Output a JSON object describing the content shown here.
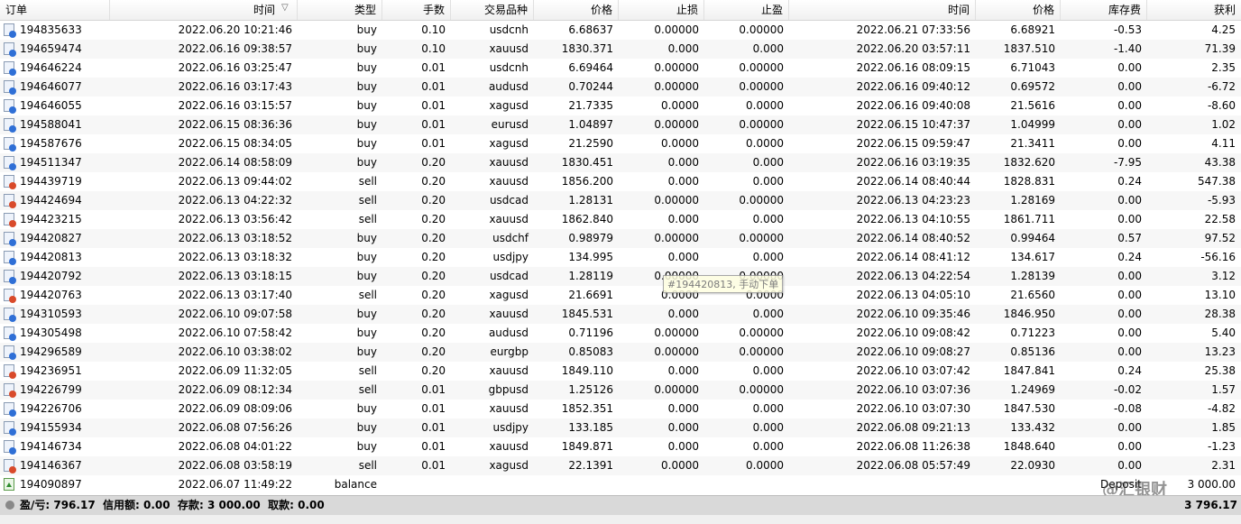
{
  "columns": [
    "订单",
    "时间",
    "类型",
    "手数",
    "交易品种",
    "价格",
    "止损",
    "止盈",
    "时间",
    "价格",
    "库存费",
    "获利"
  ],
  "sort_indicator": "▽",
  "rows": [
    {
      "order": "194835633",
      "open_time": "2022.06.20 10:21:46",
      "type": "buy",
      "lots": "0.10",
      "symbol": "usdcnh",
      "open_price": "6.68637",
      "sl": "0.00000",
      "tp": "0.00000",
      "close_time": "2022.06.21 07:33:56",
      "close_price": "6.68921",
      "swap": "-0.53",
      "profit": "4.25"
    },
    {
      "order": "194659474",
      "open_time": "2022.06.16 09:38:57",
      "type": "buy",
      "lots": "0.10",
      "symbol": "xauusd",
      "open_price": "1830.371",
      "sl": "0.000",
      "tp": "0.000",
      "close_time": "2022.06.20 03:57:11",
      "close_price": "1837.510",
      "swap": "-1.40",
      "profit": "71.39"
    },
    {
      "order": "194646224",
      "open_time": "2022.06.16 03:25:47",
      "type": "buy",
      "lots": "0.01",
      "symbol": "usdcnh",
      "open_price": "6.69464",
      "sl": "0.00000",
      "tp": "0.00000",
      "close_time": "2022.06.16 08:09:15",
      "close_price": "6.71043",
      "swap": "0.00",
      "profit": "2.35"
    },
    {
      "order": "194646077",
      "open_time": "2022.06.16 03:17:43",
      "type": "buy",
      "lots": "0.01",
      "symbol": "audusd",
      "open_price": "0.70244",
      "sl": "0.00000",
      "tp": "0.00000",
      "close_time": "2022.06.16 09:40:12",
      "close_price": "0.69572",
      "swap": "0.00",
      "profit": "-6.72"
    },
    {
      "order": "194646055",
      "open_time": "2022.06.16 03:15:57",
      "type": "buy",
      "lots": "0.01",
      "symbol": "xagusd",
      "open_price": "21.7335",
      "sl": "0.0000",
      "tp": "0.0000",
      "close_time": "2022.06.16 09:40:08",
      "close_price": "21.5616",
      "swap": "0.00",
      "profit": "-8.60"
    },
    {
      "order": "194588041",
      "open_time": "2022.06.15 08:36:36",
      "type": "buy",
      "lots": "0.01",
      "symbol": "eurusd",
      "open_price": "1.04897",
      "sl": "0.00000",
      "tp": "0.00000",
      "close_time": "2022.06.15 10:47:37",
      "close_price": "1.04999",
      "swap": "0.00",
      "profit": "1.02"
    },
    {
      "order": "194587676",
      "open_time": "2022.06.15 08:34:05",
      "type": "buy",
      "lots": "0.01",
      "symbol": "xagusd",
      "open_price": "21.2590",
      "sl": "0.0000",
      "tp": "0.0000",
      "close_time": "2022.06.15 09:59:47",
      "close_price": "21.3411",
      "swap": "0.00",
      "profit": "4.11"
    },
    {
      "order": "194511347",
      "open_time": "2022.06.14 08:58:09",
      "type": "buy",
      "lots": "0.20",
      "symbol": "xauusd",
      "open_price": "1830.451",
      "sl": "0.000",
      "tp": "0.000",
      "close_time": "2022.06.16 03:19:35",
      "close_price": "1832.620",
      "swap": "-7.95",
      "profit": "43.38"
    },
    {
      "order": "194439719",
      "open_time": "2022.06.13 09:44:02",
      "type": "sell",
      "lots": "0.20",
      "symbol": "xauusd",
      "open_price": "1856.200",
      "sl": "0.000",
      "tp": "0.000",
      "close_time": "2022.06.14 08:40:44",
      "close_price": "1828.831",
      "swap": "0.24",
      "profit": "547.38"
    },
    {
      "order": "194424694",
      "open_time": "2022.06.13 04:22:32",
      "type": "sell",
      "lots": "0.20",
      "symbol": "usdcad",
      "open_price": "1.28131",
      "sl": "0.00000",
      "tp": "0.00000",
      "close_time": "2022.06.13 04:23:23",
      "close_price": "1.28169",
      "swap": "0.00",
      "profit": "-5.93"
    },
    {
      "order": "194423215",
      "open_time": "2022.06.13 03:56:42",
      "type": "sell",
      "lots": "0.20",
      "symbol": "xauusd",
      "open_price": "1862.840",
      "sl": "0.000",
      "tp": "0.000",
      "close_time": "2022.06.13 04:10:55",
      "close_price": "1861.711",
      "swap": "0.00",
      "profit": "22.58"
    },
    {
      "order": "194420827",
      "open_time": "2022.06.13 03:18:52",
      "type": "buy",
      "lots": "0.20",
      "symbol": "usdchf",
      "open_price": "0.98979",
      "sl": "0.00000",
      "tp": "0.00000",
      "close_time": "2022.06.14 08:40:52",
      "close_price": "0.99464",
      "swap": "0.57",
      "profit": "97.52"
    },
    {
      "order": "194420813",
      "open_time": "2022.06.13 03:18:32",
      "type": "buy",
      "lots": "0.20",
      "symbol": "usdjpy",
      "open_price": "134.995",
      "sl": "0.000",
      "tp": "0.000",
      "close_time": "2022.06.14 08:41:12",
      "close_price": "134.617",
      "swap": "0.24",
      "profit": "-56.16"
    },
    {
      "order": "194420792",
      "open_time": "2022.06.13 03:18:15",
      "type": "buy",
      "lots": "0.20",
      "symbol": "usdcad",
      "open_price": "1.28119",
      "sl": "0.00000",
      "tp": "0.00000",
      "close_time": "2022.06.13 04:22:54",
      "close_price": "1.28139",
      "swap": "0.00",
      "profit": "3.12"
    },
    {
      "order": "194420763",
      "open_time": "2022.06.13 03:17:40",
      "type": "sell",
      "lots": "0.20",
      "symbol": "xagusd",
      "open_price": "21.6691",
      "sl": "0.0000",
      "tp": "0.0000",
      "close_time": "2022.06.13 04:05:10",
      "close_price": "21.6560",
      "swap": "0.00",
      "profit": "13.10"
    },
    {
      "order": "194310593",
      "open_time": "2022.06.10 09:07:58",
      "type": "buy",
      "lots": "0.20",
      "symbol": "xauusd",
      "open_price": "1845.531",
      "sl": "0.000",
      "tp": "0.000",
      "close_time": "2022.06.10 09:35:46",
      "close_price": "1846.950",
      "swap": "0.00",
      "profit": "28.38"
    },
    {
      "order": "194305498",
      "open_time": "2022.06.10 07:58:42",
      "type": "buy",
      "lots": "0.20",
      "symbol": "audusd",
      "open_price": "0.71196",
      "sl": "0.00000",
      "tp": "0.00000",
      "close_time": "2022.06.10 09:08:42",
      "close_price": "0.71223",
      "swap": "0.00",
      "profit": "5.40"
    },
    {
      "order": "194296589",
      "open_time": "2022.06.10 03:38:02",
      "type": "buy",
      "lots": "0.20",
      "symbol": "eurgbp",
      "open_price": "0.85083",
      "sl": "0.00000",
      "tp": "0.00000",
      "close_time": "2022.06.10 09:08:27",
      "close_price": "0.85136",
      "swap": "0.00",
      "profit": "13.23"
    },
    {
      "order": "194236951",
      "open_time": "2022.06.09 11:32:05",
      "type": "sell",
      "lots": "0.20",
      "symbol": "xauusd",
      "open_price": "1849.110",
      "sl": "0.000",
      "tp": "0.000",
      "close_time": "2022.06.10 03:07:42",
      "close_price": "1847.841",
      "swap": "0.24",
      "profit": "25.38"
    },
    {
      "order": "194226799",
      "open_time": "2022.06.09 08:12:34",
      "type": "sell",
      "lots": "0.01",
      "symbol": "gbpusd",
      "open_price": "1.25126",
      "sl": "0.00000",
      "tp": "0.00000",
      "close_time": "2022.06.10 03:07:36",
      "close_price": "1.24969",
      "swap": "-0.02",
      "profit": "1.57"
    },
    {
      "order": "194226706",
      "open_time": "2022.06.09 08:09:06",
      "type": "buy",
      "lots": "0.01",
      "symbol": "xauusd",
      "open_price": "1852.351",
      "sl": "0.000",
      "tp": "0.000",
      "close_time": "2022.06.10 03:07:30",
      "close_price": "1847.530",
      "swap": "-0.08",
      "profit": "-4.82"
    },
    {
      "order": "194155934",
      "open_time": "2022.06.08 07:56:26",
      "type": "buy",
      "lots": "0.01",
      "symbol": "usdjpy",
      "open_price": "133.185",
      "sl": "0.000",
      "tp": "0.000",
      "close_time": "2022.06.08 09:21:13",
      "close_price": "133.432",
      "swap": "0.00",
      "profit": "1.85"
    },
    {
      "order": "194146734",
      "open_time": "2022.06.08 04:01:22",
      "type": "buy",
      "lots": "0.01",
      "symbol": "xauusd",
      "open_price": "1849.871",
      "sl": "0.000",
      "tp": "0.000",
      "close_time": "2022.06.08 11:26:38",
      "close_price": "1848.640",
      "swap": "0.00",
      "profit": "-1.23"
    },
    {
      "order": "194146367",
      "open_time": "2022.06.08 03:58:19",
      "type": "sell",
      "lots": "0.01",
      "symbol": "xagusd",
      "open_price": "22.1391",
      "sl": "0.0000",
      "tp": "0.0000",
      "close_time": "2022.06.08 05:57:49",
      "close_price": "22.0930",
      "swap": "0.00",
      "profit": "2.31"
    },
    {
      "order": "194090897",
      "open_time": "2022.06.07 11:49:22",
      "type": "balance",
      "lots": "",
      "symbol": "",
      "open_price": "",
      "sl": "",
      "tp": "",
      "close_time": "",
      "close_price": "",
      "swap": "",
      "profit": "3 000.00"
    }
  ],
  "deposit_label": "Deposit",
  "tooltip": "#194420813, 手动下单",
  "footer": {
    "summary": "盈/亏: 796.17  信用额: 0.00  存款: 3 000.00  取款: 0.00",
    "total": "3 796.17"
  },
  "watermark": "@汇银财"
}
